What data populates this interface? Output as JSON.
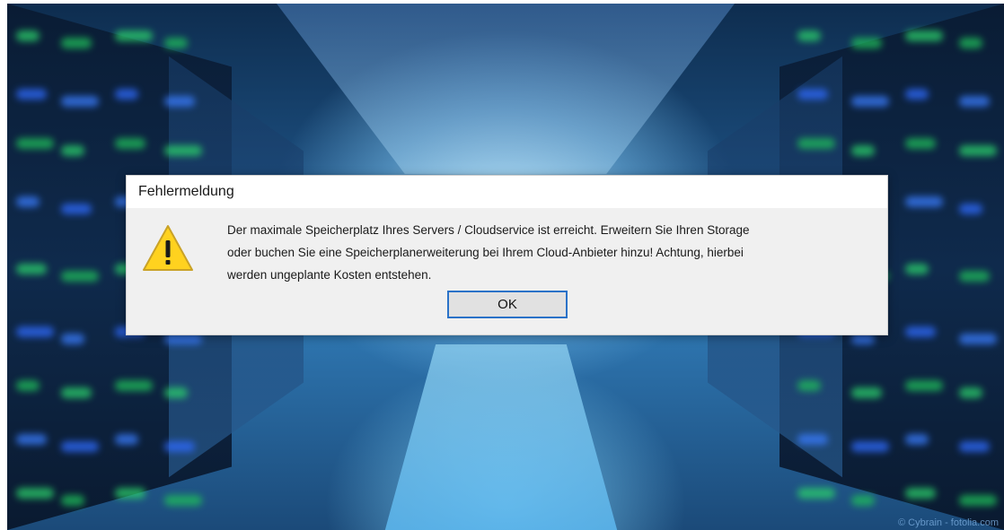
{
  "dialog": {
    "title": "Fehlermeldung",
    "icon": "warning-icon",
    "message_lines": [
      "Der maximale Speicherplatz Ihres Servers / Cloudservice ist erreicht. Erweitern Sie Ihren Storage",
      "oder buchen Sie eine Speicherplanerweiterung bei Ihrem Cloud-Anbieter hinzu! Achtung, hierbei",
      "werden ungeplante Kosten entstehen."
    ],
    "ok_label": "OK"
  },
  "background": {
    "watermark": "© Cybrain - fotolia.com"
  },
  "colors": {
    "warning_fill": "#ffd21f",
    "warning_stroke": "#b8860b",
    "button_border": "#2a72c8",
    "dialog_body": "#f0f0f0",
    "titlebar": "#ffffff"
  }
}
